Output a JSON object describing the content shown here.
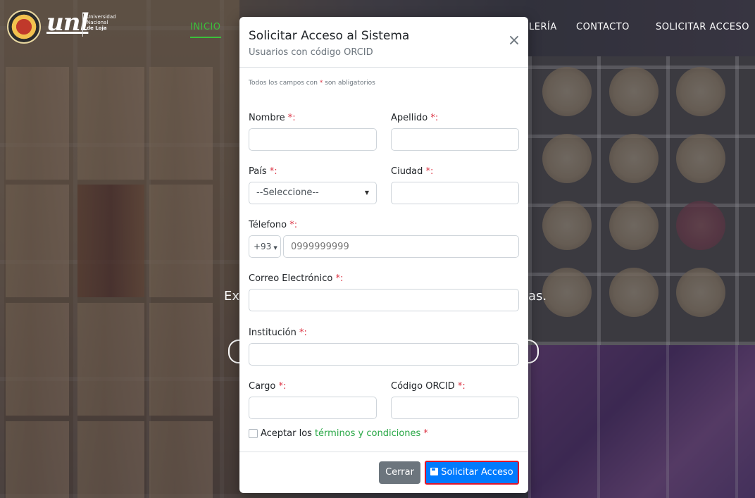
{
  "brand": {
    "logo_mark": "unl",
    "university_lines": [
      "Universidad",
      "Nacional",
      "de Loja"
    ],
    "seal_year": "1859"
  },
  "nav": {
    "items": [
      "INICIO",
      "LERÍA",
      "CONTACTO",
      "SOLICITAR ACCESO"
    ],
    "active": "INICIO",
    "active_color": "#3bc03b"
  },
  "background": {
    "partial_left": "Ex",
    "partial_right": "as."
  },
  "modal": {
    "title": "Solicitar Acceso al Sistema",
    "subtitle": "Usuarios con código ORCID",
    "close_icon": "close-icon",
    "note_prefix": "Todos los campos con",
    "note_star": "*",
    "note_suffix": "son abligatorios",
    "fields": {
      "nombre": {
        "label": "Nombre",
        "value": ""
      },
      "apellido": {
        "label": "Apellido",
        "value": ""
      },
      "pais": {
        "label": "País",
        "selected": "--Seleccione--"
      },
      "ciudad": {
        "label": "Ciudad",
        "value": ""
      },
      "telefono": {
        "label": "Télefono",
        "prefix": "+93",
        "placeholder": "0999999999"
      },
      "correo": {
        "label": "Correo Electrónico",
        "value": ""
      },
      "institucion": {
        "label": "Institución",
        "value": ""
      },
      "cargo": {
        "label": "Cargo",
        "value": ""
      },
      "orcid": {
        "label": "Código ORCID",
        "value": ""
      }
    },
    "required_marker": "*:",
    "terms": {
      "prefix": "Aceptar los",
      "link": "términos y condiciones",
      "star": "*"
    },
    "footer": {
      "close_label": "Cerrar",
      "submit_label": "Solicitar Acceso",
      "submit_icon": "save-icon",
      "submit_color": "#007bff",
      "highlight_color": "#e0152b"
    }
  }
}
